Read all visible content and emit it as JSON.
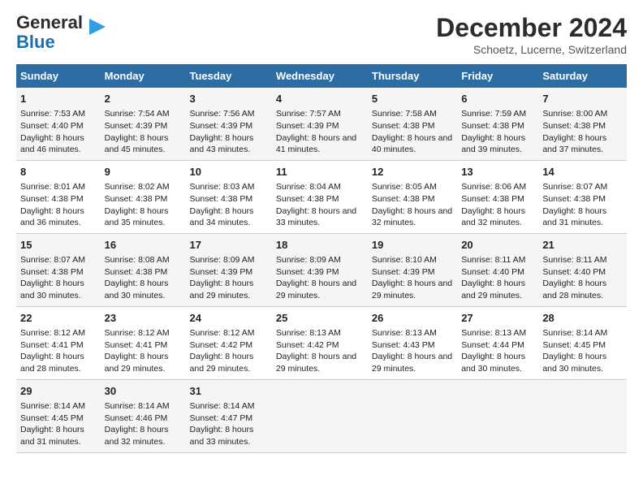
{
  "header": {
    "logo_general": "General",
    "logo_blue": "Blue",
    "main_title": "December 2024",
    "subtitle": "Schoetz, Lucerne, Switzerland"
  },
  "days_of_week": [
    "Sunday",
    "Monday",
    "Tuesday",
    "Wednesday",
    "Thursday",
    "Friday",
    "Saturday"
  ],
  "weeks": [
    [
      {
        "day": "1",
        "sunrise": "Sunrise: 7:53 AM",
        "sunset": "Sunset: 4:40 PM",
        "daylight": "Daylight: 8 hours and 46 minutes."
      },
      {
        "day": "2",
        "sunrise": "Sunrise: 7:54 AM",
        "sunset": "Sunset: 4:39 PM",
        "daylight": "Daylight: 8 hours and 45 minutes."
      },
      {
        "day": "3",
        "sunrise": "Sunrise: 7:56 AM",
        "sunset": "Sunset: 4:39 PM",
        "daylight": "Daylight: 8 hours and 43 minutes."
      },
      {
        "day": "4",
        "sunrise": "Sunrise: 7:57 AM",
        "sunset": "Sunset: 4:39 PM",
        "daylight": "Daylight: 8 hours and 41 minutes."
      },
      {
        "day": "5",
        "sunrise": "Sunrise: 7:58 AM",
        "sunset": "Sunset: 4:38 PM",
        "daylight": "Daylight: 8 hours and 40 minutes."
      },
      {
        "day": "6",
        "sunrise": "Sunrise: 7:59 AM",
        "sunset": "Sunset: 4:38 PM",
        "daylight": "Daylight: 8 hours and 39 minutes."
      },
      {
        "day": "7",
        "sunrise": "Sunrise: 8:00 AM",
        "sunset": "Sunset: 4:38 PM",
        "daylight": "Daylight: 8 hours and 37 minutes."
      }
    ],
    [
      {
        "day": "8",
        "sunrise": "Sunrise: 8:01 AM",
        "sunset": "Sunset: 4:38 PM",
        "daylight": "Daylight: 8 hours and 36 minutes."
      },
      {
        "day": "9",
        "sunrise": "Sunrise: 8:02 AM",
        "sunset": "Sunset: 4:38 PM",
        "daylight": "Daylight: 8 hours and 35 minutes."
      },
      {
        "day": "10",
        "sunrise": "Sunrise: 8:03 AM",
        "sunset": "Sunset: 4:38 PM",
        "daylight": "Daylight: 8 hours and 34 minutes."
      },
      {
        "day": "11",
        "sunrise": "Sunrise: 8:04 AM",
        "sunset": "Sunset: 4:38 PM",
        "daylight": "Daylight: 8 hours and 33 minutes."
      },
      {
        "day": "12",
        "sunrise": "Sunrise: 8:05 AM",
        "sunset": "Sunset: 4:38 PM",
        "daylight": "Daylight: 8 hours and 32 minutes."
      },
      {
        "day": "13",
        "sunrise": "Sunrise: 8:06 AM",
        "sunset": "Sunset: 4:38 PM",
        "daylight": "Daylight: 8 hours and 32 minutes."
      },
      {
        "day": "14",
        "sunrise": "Sunrise: 8:07 AM",
        "sunset": "Sunset: 4:38 PM",
        "daylight": "Daylight: 8 hours and 31 minutes."
      }
    ],
    [
      {
        "day": "15",
        "sunrise": "Sunrise: 8:07 AM",
        "sunset": "Sunset: 4:38 PM",
        "daylight": "Daylight: 8 hours and 30 minutes."
      },
      {
        "day": "16",
        "sunrise": "Sunrise: 8:08 AM",
        "sunset": "Sunset: 4:38 PM",
        "daylight": "Daylight: 8 hours and 30 minutes."
      },
      {
        "day": "17",
        "sunrise": "Sunrise: 8:09 AM",
        "sunset": "Sunset: 4:39 PM",
        "daylight": "Daylight: 8 hours and 29 minutes."
      },
      {
        "day": "18",
        "sunrise": "Sunrise: 8:09 AM",
        "sunset": "Sunset: 4:39 PM",
        "daylight": "Daylight: 8 hours and 29 minutes."
      },
      {
        "day": "19",
        "sunrise": "Sunrise: 8:10 AM",
        "sunset": "Sunset: 4:39 PM",
        "daylight": "Daylight: 8 hours and 29 minutes."
      },
      {
        "day": "20",
        "sunrise": "Sunrise: 8:11 AM",
        "sunset": "Sunset: 4:40 PM",
        "daylight": "Daylight: 8 hours and 29 minutes."
      },
      {
        "day": "21",
        "sunrise": "Sunrise: 8:11 AM",
        "sunset": "Sunset: 4:40 PM",
        "daylight": "Daylight: 8 hours and 28 minutes."
      }
    ],
    [
      {
        "day": "22",
        "sunrise": "Sunrise: 8:12 AM",
        "sunset": "Sunset: 4:41 PM",
        "daylight": "Daylight: 8 hours and 28 minutes."
      },
      {
        "day": "23",
        "sunrise": "Sunrise: 8:12 AM",
        "sunset": "Sunset: 4:41 PM",
        "daylight": "Daylight: 8 hours and 29 minutes."
      },
      {
        "day": "24",
        "sunrise": "Sunrise: 8:12 AM",
        "sunset": "Sunset: 4:42 PM",
        "daylight": "Daylight: 8 hours and 29 minutes."
      },
      {
        "day": "25",
        "sunrise": "Sunrise: 8:13 AM",
        "sunset": "Sunset: 4:42 PM",
        "daylight": "Daylight: 8 hours and 29 minutes."
      },
      {
        "day": "26",
        "sunrise": "Sunrise: 8:13 AM",
        "sunset": "Sunset: 4:43 PM",
        "daylight": "Daylight: 8 hours and 29 minutes."
      },
      {
        "day": "27",
        "sunrise": "Sunrise: 8:13 AM",
        "sunset": "Sunset: 4:44 PM",
        "daylight": "Daylight: 8 hours and 30 minutes."
      },
      {
        "day": "28",
        "sunrise": "Sunrise: 8:14 AM",
        "sunset": "Sunset: 4:45 PM",
        "daylight": "Daylight: 8 hours and 30 minutes."
      }
    ],
    [
      {
        "day": "29",
        "sunrise": "Sunrise: 8:14 AM",
        "sunset": "Sunset: 4:45 PM",
        "daylight": "Daylight: 8 hours and 31 minutes."
      },
      {
        "day": "30",
        "sunrise": "Sunrise: 8:14 AM",
        "sunset": "Sunset: 4:46 PM",
        "daylight": "Daylight: 8 hours and 32 minutes."
      },
      {
        "day": "31",
        "sunrise": "Sunrise: 8:14 AM",
        "sunset": "Sunset: 4:47 PM",
        "daylight": "Daylight: 8 hours and 33 minutes."
      },
      null,
      null,
      null,
      null
    ]
  ]
}
